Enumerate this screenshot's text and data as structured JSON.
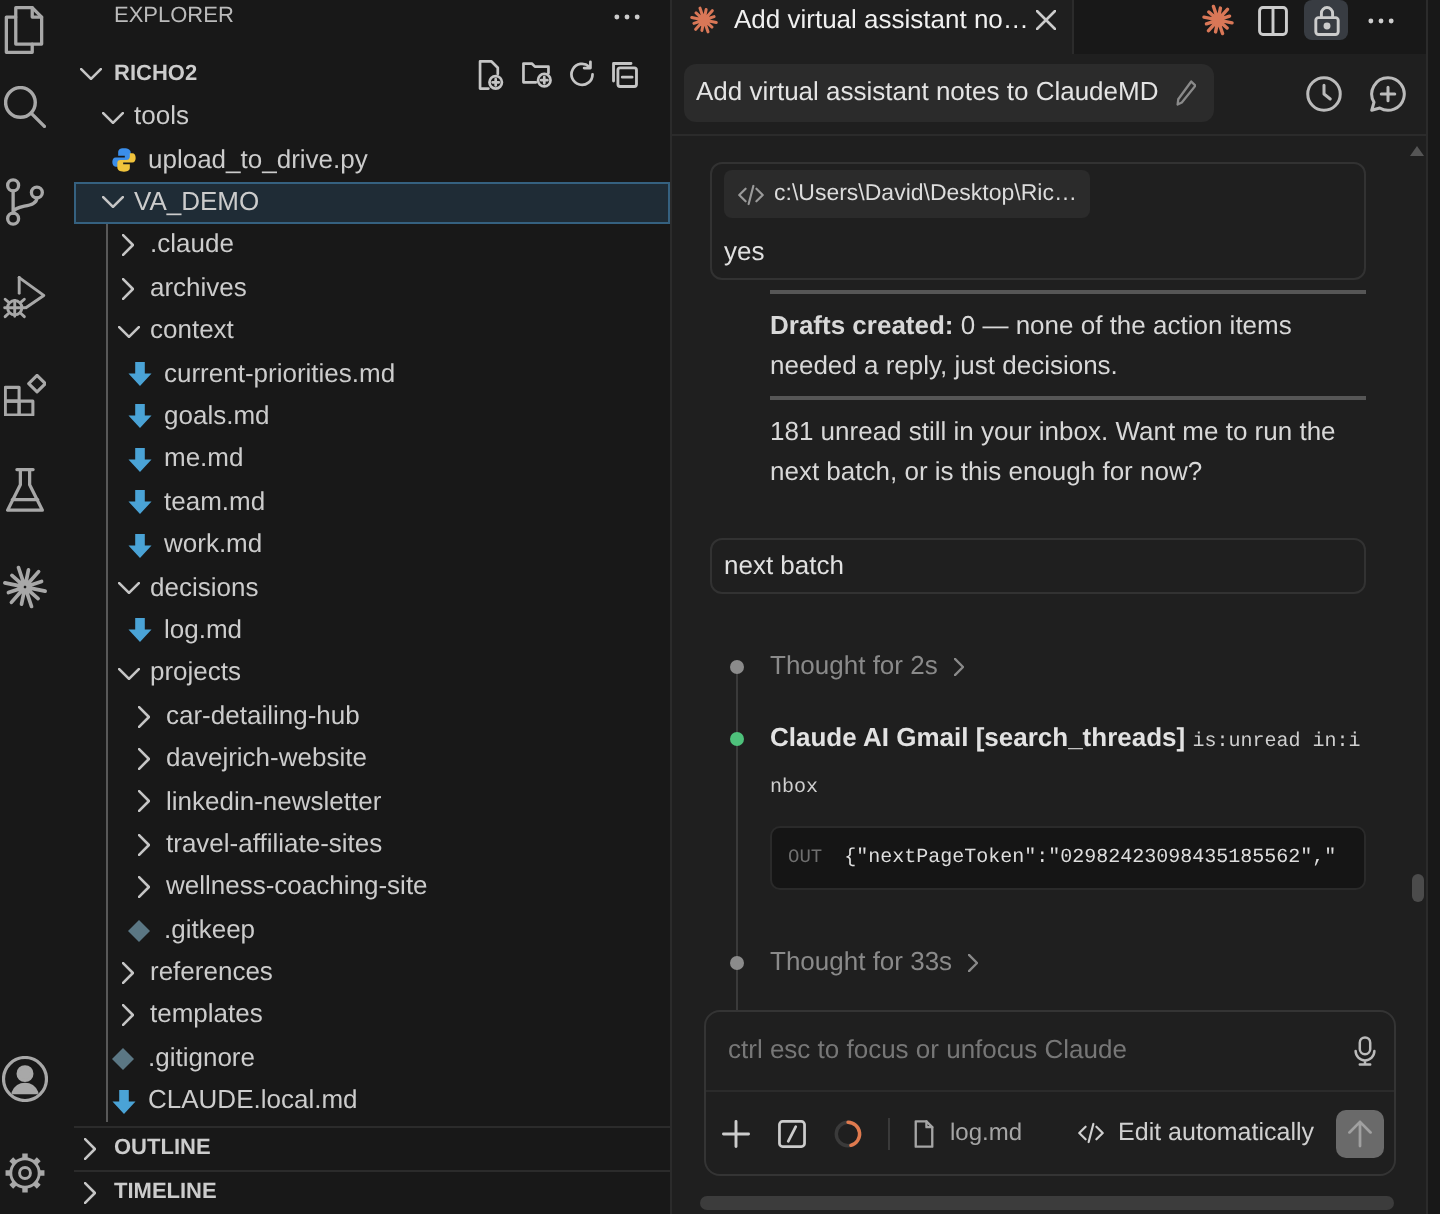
{
  "sidebar": {
    "title": "EXPLORER",
    "workspace": {
      "name": "RICHO2",
      "expanded": true
    },
    "tree": [
      {
        "label": "tools",
        "kind": "folder",
        "expanded": true,
        "selected": false,
        "children": [
          {
            "label": "upload_to_drive.py",
            "kind": "python",
            "selected": false
          }
        ]
      },
      {
        "label": "VA_DEMO",
        "kind": "folder",
        "expanded": true,
        "selected": true,
        "children": [
          {
            "label": ".claude",
            "kind": "folder",
            "expanded": false,
            "selected": false
          },
          {
            "label": "archives",
            "kind": "folder",
            "expanded": false,
            "selected": false
          },
          {
            "label": "context",
            "kind": "folder",
            "expanded": true,
            "selected": false,
            "children": [
              {
                "label": "current-priorities.md",
                "kind": "markdown",
                "selected": false
              },
              {
                "label": "goals.md",
                "kind": "markdown",
                "selected": false
              },
              {
                "label": "me.md",
                "kind": "markdown",
                "selected": false
              },
              {
                "label": "team.md",
                "kind": "markdown",
                "selected": false
              },
              {
                "label": "work.md",
                "kind": "markdown",
                "selected": false
              }
            ]
          },
          {
            "label": "decisions",
            "kind": "folder",
            "expanded": true,
            "selected": false,
            "children": [
              {
                "label": "log.md",
                "kind": "markdown",
                "selected": false
              }
            ]
          },
          {
            "label": "projects",
            "kind": "folder",
            "expanded": true,
            "selected": false,
            "children": [
              {
                "label": "car-detailing-hub",
                "kind": "folder",
                "expanded": false,
                "selected": false
              },
              {
                "label": "davejrich-website",
                "kind": "folder",
                "expanded": false,
                "selected": false
              },
              {
                "label": "linkedin-newsletter",
                "kind": "folder",
                "expanded": false,
                "selected": false
              },
              {
                "label": "travel-affiliate-sites",
                "kind": "folder",
                "expanded": false,
                "selected": false
              },
              {
                "label": "wellness-coaching-site",
                "kind": "folder",
                "expanded": false,
                "selected": false
              },
              {
                "label": ".gitkeep",
                "kind": "git",
                "selected": false
              }
            ]
          },
          {
            "label": "references",
            "kind": "folder",
            "expanded": false,
            "selected": false
          },
          {
            "label": "templates",
            "kind": "folder",
            "expanded": false,
            "selected": false
          },
          {
            "label": ".gitignore",
            "kind": "git",
            "selected": false
          },
          {
            "label": "CLAUDE.local.md",
            "kind": "markdown",
            "selected": false
          }
        ]
      }
    ],
    "sections": [
      {
        "title": "OUTLINE",
        "expanded": false
      },
      {
        "title": "TIMELINE",
        "expanded": false
      }
    ]
  },
  "editor": {
    "tabs": [
      {
        "title": "Add virtual assistant no…",
        "selected": true
      }
    ],
    "lock_button": {
      "on": true
    }
  },
  "chat": {
    "title": "Add virtual assistant notes to ClaudeMD",
    "messages": [
      {
        "kind": "user",
        "attachment": "c:\\Users\\David\\Desktop\\Ric…",
        "text": "yes"
      },
      {
        "kind": "assistant",
        "blocks": [
          {
            "kind": "rule"
          },
          {
            "kind": "paragraph",
            "text": "**Drafts created:** 0 — none of the action items needed a reply, just decisions."
          },
          {
            "kind": "rule"
          },
          {
            "kind": "paragraph",
            "text": "181 unread still in your inbox. Want me to run the next batch, or is this enough for now?"
          }
        ]
      },
      {
        "kind": "user",
        "text": "next batch"
      },
      {
        "kind": "steps",
        "steps": [
          {
            "kind": "thought",
            "text": "Thought for 2s",
            "color": "#8b8b8b"
          },
          {
            "kind": "tool",
            "title": "Claude AI Gmail [search_threads]",
            "query": "is:unread in:inbox",
            "output_label": "OUT",
            "output": "{\"nextPageToken\":\"02982423098435185562\",\"",
            "color": "#4ec17b"
          },
          {
            "kind": "thought",
            "text": "Thought for 33s",
            "color": "#8b8b8b"
          }
        ]
      }
    ],
    "composer": {
      "placeholder": "ctrl esc to focus or unfocus Claude",
      "file": "log.md",
      "mode": "Edit automatically",
      "send_button": {
        "disabled": true
      }
    }
  }
}
